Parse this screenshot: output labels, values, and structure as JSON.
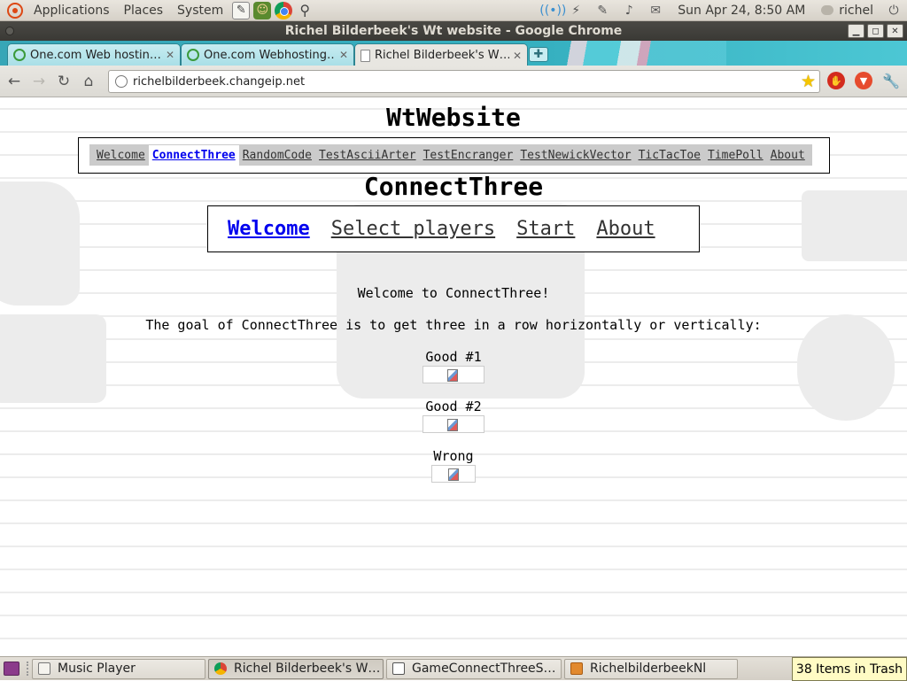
{
  "top_panel": {
    "menus": [
      "Applications",
      "Places",
      "System"
    ],
    "clock": "Sun Apr 24,  8:50 AM",
    "user": "richel"
  },
  "window": {
    "title": "Richel Bilderbeek's Wt website - Google Chrome"
  },
  "tabs": [
    {
      "label": "One.com Web hostin…",
      "active": false
    },
    {
      "label": "One.com Webhosting…",
      "active": false
    },
    {
      "label": "Richel Bilderbeek's W…",
      "active": true
    }
  ],
  "toolbar": {
    "url": "richelbilderbeek.changeip.net"
  },
  "page": {
    "site_title": "WtWebsite",
    "site_menu": [
      "Welcome",
      "ConnectThree",
      "RandomCode",
      "TestAsciiArter",
      "TestEncranger",
      "TestNewickVector",
      "TicTacToe",
      "TimePoll",
      "About"
    ],
    "site_menu_selected": 1,
    "app_title": "ConnectThree",
    "app_menu": [
      "Welcome",
      "Select players",
      "Start",
      "About"
    ],
    "app_menu_selected": 0,
    "welcome_text": "Welcome to ConnectThree!",
    "goal_text": "The goal of ConnectThree is to get three in a row horizontally or vertically:",
    "examples": [
      {
        "label": "Good #1"
      },
      {
        "label": "Good #2"
      },
      {
        "label": "Wrong"
      }
    ]
  },
  "bottom_panel": {
    "tasks": [
      {
        "label": "Music Player",
        "icon": "music-icon"
      },
      {
        "label": "Richel Bilderbeek's W…",
        "icon": "chrome-icon",
        "active": true
      },
      {
        "label": "GameConnectThreeS…",
        "icon": "text-editor-icon"
      },
      {
        "label": "RichelbilderbeekNl",
        "icon": "folder-icon"
      }
    ],
    "trash_tip": "38 Items in Trash"
  },
  "colors": {
    "link_selected": "#0000ee",
    "tab_strip": "#36b0c0",
    "panel": "#dcd8d0"
  }
}
